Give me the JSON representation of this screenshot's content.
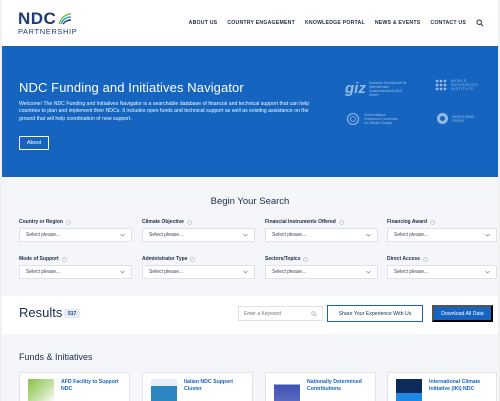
{
  "header": {
    "logo_main": "NDC",
    "logo_sub": "PARTNERSHIP",
    "nav": [
      "ABOUT US",
      "COUNTRY ENGAGEMENT",
      "KNOWLEDGE PORTAL",
      "NEWS & EVENTS",
      "CONTACT US"
    ]
  },
  "hero": {
    "title": "NDC Funding and Initiatives Navigator",
    "text": "Welcome! The NDC Funding and Initiatives Navigator is a searchable database of financial and technical support that can help countries to plan and implement their NDCs. It includes open funds and technical support as well as existing assistance on the ground that will help coordination of new support.",
    "about_label": "About",
    "partners": [
      {
        "mark": "giz",
        "text": "Deutsche Gesellschaft für Internationale Zusammenarbeit (GIZ) GmbH"
      },
      {
        "mark": "WRI",
        "text": "WORLD RESOURCES INSTITUTE"
      },
      {
        "mark": "UN",
        "text": "United Nations Framework Convention on Climate Change"
      },
      {
        "mark": "WB",
        "text": "WORLD BANK GROUP"
      }
    ]
  },
  "search": {
    "title": "Begin Your Search",
    "placeholder": "Select please...",
    "filters": [
      "Country or Region",
      "Climate Objective",
      "Financial Instruments Offered",
      "Financing Award",
      "Mode of Support",
      "Administrator Type",
      "Sectors/Topics",
      "Direct Access"
    ]
  },
  "results": {
    "title": "Results",
    "count": "517",
    "keyword_placeholder": "Enter a Keyword",
    "share_label": "Share Your Experience With Us",
    "download_label": "Download All Data"
  },
  "funds": {
    "title": "Funds & Initiatives",
    "cards": [
      {
        "title": "AFD Facility to Support NDC",
        "thumb_color": "#8bc34a"
      },
      {
        "title": "Italian NDC Support Cluster",
        "thumb_color": "#2e86c1"
      },
      {
        "title": "Nationally Determined Contributions",
        "thumb_color": "#3f51b5"
      },
      {
        "title": "International Climate Initiative (IKI) NDC",
        "thumb_color": "#0d2b5a"
      }
    ]
  },
  "colors": {
    "brand_blue": "#1565c0",
    "navy": "#1f3c78",
    "bg_light": "#f4f6f9"
  }
}
